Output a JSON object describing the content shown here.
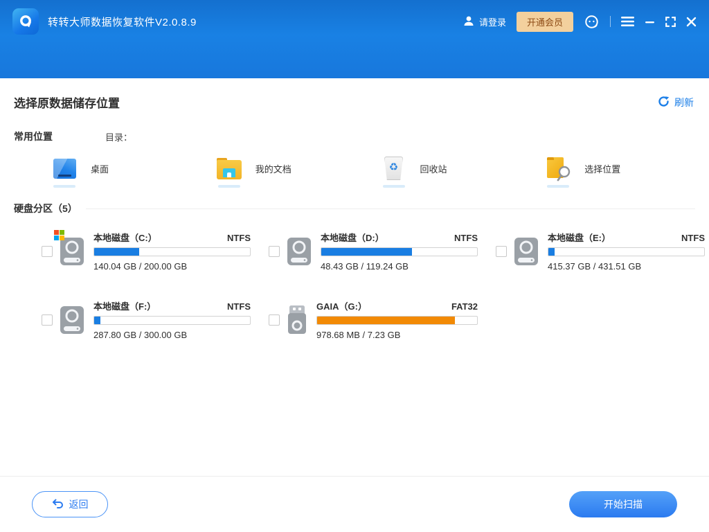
{
  "window": {
    "title": "转转大师数据恢复软件V2.0.8.9",
    "login_label": "请登录",
    "vip_label": "开通会员"
  },
  "page": {
    "title": "选择原数据储存位置",
    "refresh_label": "刷新"
  },
  "common_locations": {
    "section_label": "常用位置",
    "directory_label": "目录：",
    "items": [
      {
        "label": "桌面",
        "icon": "desktop-icon"
      },
      {
        "label": "我的文档",
        "icon": "documents-folder-icon"
      },
      {
        "label": "回收站",
        "icon": "recycle-bin-icon"
      },
      {
        "label": "选择位置",
        "icon": "select-location-icon"
      }
    ]
  },
  "partitions": {
    "section_label": "硬盘分区（5）",
    "drives": [
      {
        "name": "本地磁盘（C:）",
        "fs": "NTFS",
        "usage": "140.04 GB / 200.00 GB",
        "fill_percent": 29,
        "bar_color": "#1a7ee2",
        "icon": "hdd",
        "windows_badge": true
      },
      {
        "name": "本地磁盘（D:）",
        "fs": "NTFS",
        "usage": "48.43 GB / 119.24 GB",
        "fill_percent": 58,
        "bar_color": "#1a7ee2",
        "icon": "hdd",
        "windows_badge": false
      },
      {
        "name": "本地磁盘（E:）",
        "fs": "NTFS",
        "usage": "415.37 GB / 431.51 GB",
        "fill_percent": 4,
        "bar_color": "#1a7ee2",
        "icon": "hdd",
        "windows_badge": false
      },
      {
        "name": "本地磁盘（F:）",
        "fs": "NTFS",
        "usage": "287.80 GB / 300.00 GB",
        "fill_percent": 4,
        "bar_color": "#1a7ee2",
        "icon": "hdd",
        "windows_badge": false
      },
      {
        "name": "GAIA（G:）",
        "fs": "FAT32",
        "usage": "978.68 MB / 7.23 GB",
        "fill_percent": 86,
        "bar_color": "#f28a05",
        "icon": "usb",
        "windows_badge": false
      }
    ]
  },
  "footer": {
    "back_label": "返回",
    "scan_label": "开始扫描"
  },
  "colors": {
    "header_blue": "#1877dc",
    "accent_blue": "#1c7fe8",
    "bar_blue": "#1a7ee2",
    "bar_orange": "#f28a05",
    "vip_bg": "#f3d09d",
    "vip_text": "#8c4a15",
    "windows_badge": [
      "#f25022",
      "#7fba00",
      "#00a4ef",
      "#ffb900"
    ],
    "recycle_glyph": "♻"
  }
}
